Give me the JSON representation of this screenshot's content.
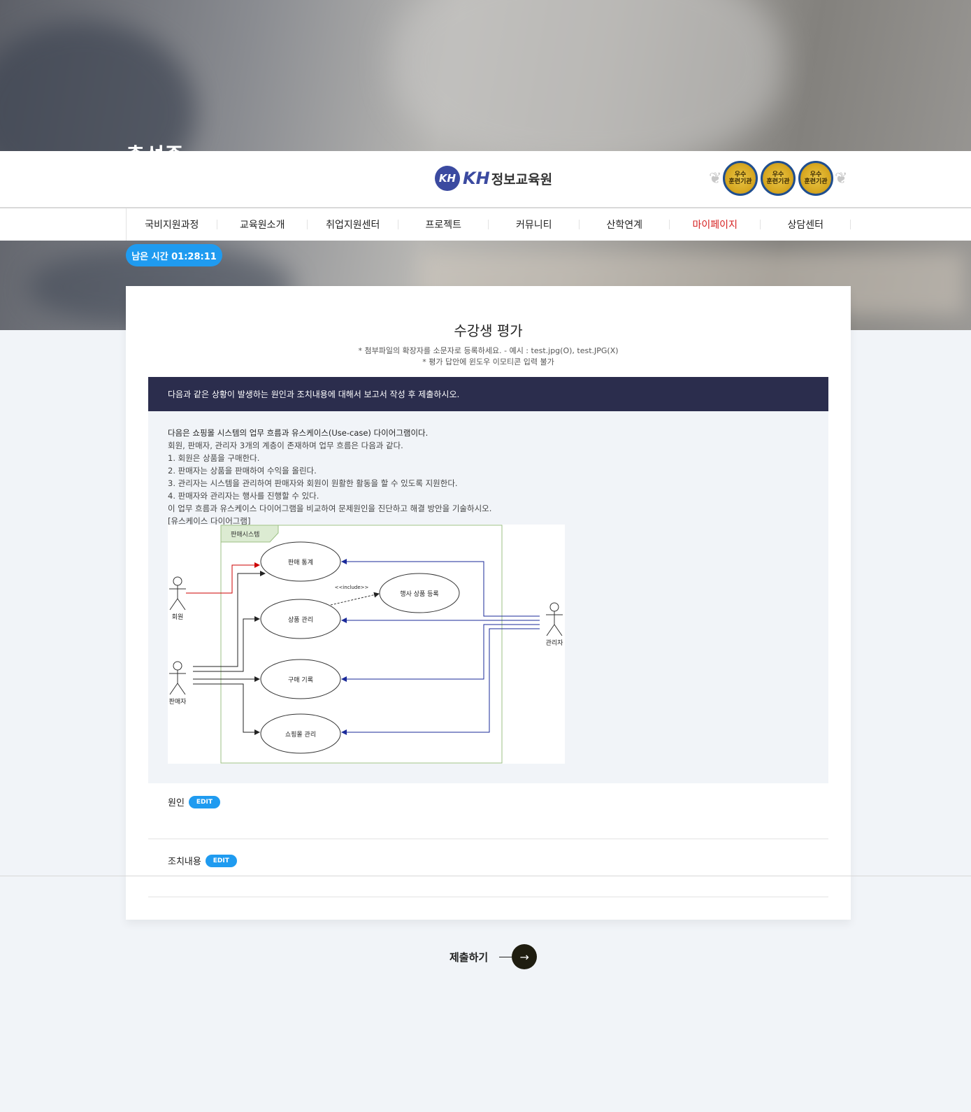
{
  "hero": {
    "title_cut": "출석중"
  },
  "logo": {
    "mark": "KH",
    "brand": "KH",
    "name": "정보교육원"
  },
  "badges": [
    {
      "line1": "우수",
      "line2": "훈련기관"
    },
    {
      "line1": "우수",
      "line2": "훈련기관"
    },
    {
      "line1": "우수",
      "line2": "훈련기관"
    }
  ],
  "nav": {
    "items": [
      "국비지원과정",
      "교육원소개",
      "취업지원센터",
      "프로젝트",
      "커뮤니티",
      "산학연계",
      "마이페이지",
      "상담센터"
    ],
    "active": "마이페이지"
  },
  "timer": {
    "label": "남은 시간 01:28:11"
  },
  "card": {
    "title": "수강생 평가",
    "note1": "* 첨부파일의 확장자를 소문자로 등록하세요. - 예시 : test.jpg(O), test.JPG(X)",
    "note2": "* 평가 답안에 윈도우 이모티콘 입력 불가"
  },
  "question": {
    "heading": "다음과 같은 상황이 발생하는 원인과 조치내용에 대해서 보고서 작성 후 제출하시오.",
    "lines": [
      "다음은 쇼핑몰 시스템의 업무 흐름과 유스케이스(Use-case) 다이어그램이다.",
      "회원, 판매자, 관리자 3개의 계층이 존재하며 업무 흐름은 다음과 같다.",
      "1. 회원은 상품을 구매한다.",
      "2. 판매자는 상품을 판매하여 수익을 올린다.",
      "3. 관리자는 시스템을 관리하여 판매자와 회원이 원활한 활동을 할 수 있도록 지원한다.",
      "4. 판매자와 관리자는 행사를 진행할 수 있다.",
      "이 업무 흐름과 유스케이스 다이어그램을 비교하여 문제원인을 진단하고 해결 방안을 기술하시오.",
      "[유스케이스 다이어그램]"
    ]
  },
  "diagram": {
    "system": "판매시스템",
    "usecases": [
      "판매 통계",
      "행사 상품 등록",
      "상품 관리",
      "구매 기록",
      "쇼핑몰 관리"
    ],
    "actors": [
      "회원",
      "판매자",
      "관리자"
    ],
    "include": "<<include>>"
  },
  "answers": {
    "cause_label": "원인",
    "action_label": "조치내용",
    "edit_label": "EDIT"
  },
  "submit": {
    "label": "제출하기",
    "arrow": "→"
  }
}
